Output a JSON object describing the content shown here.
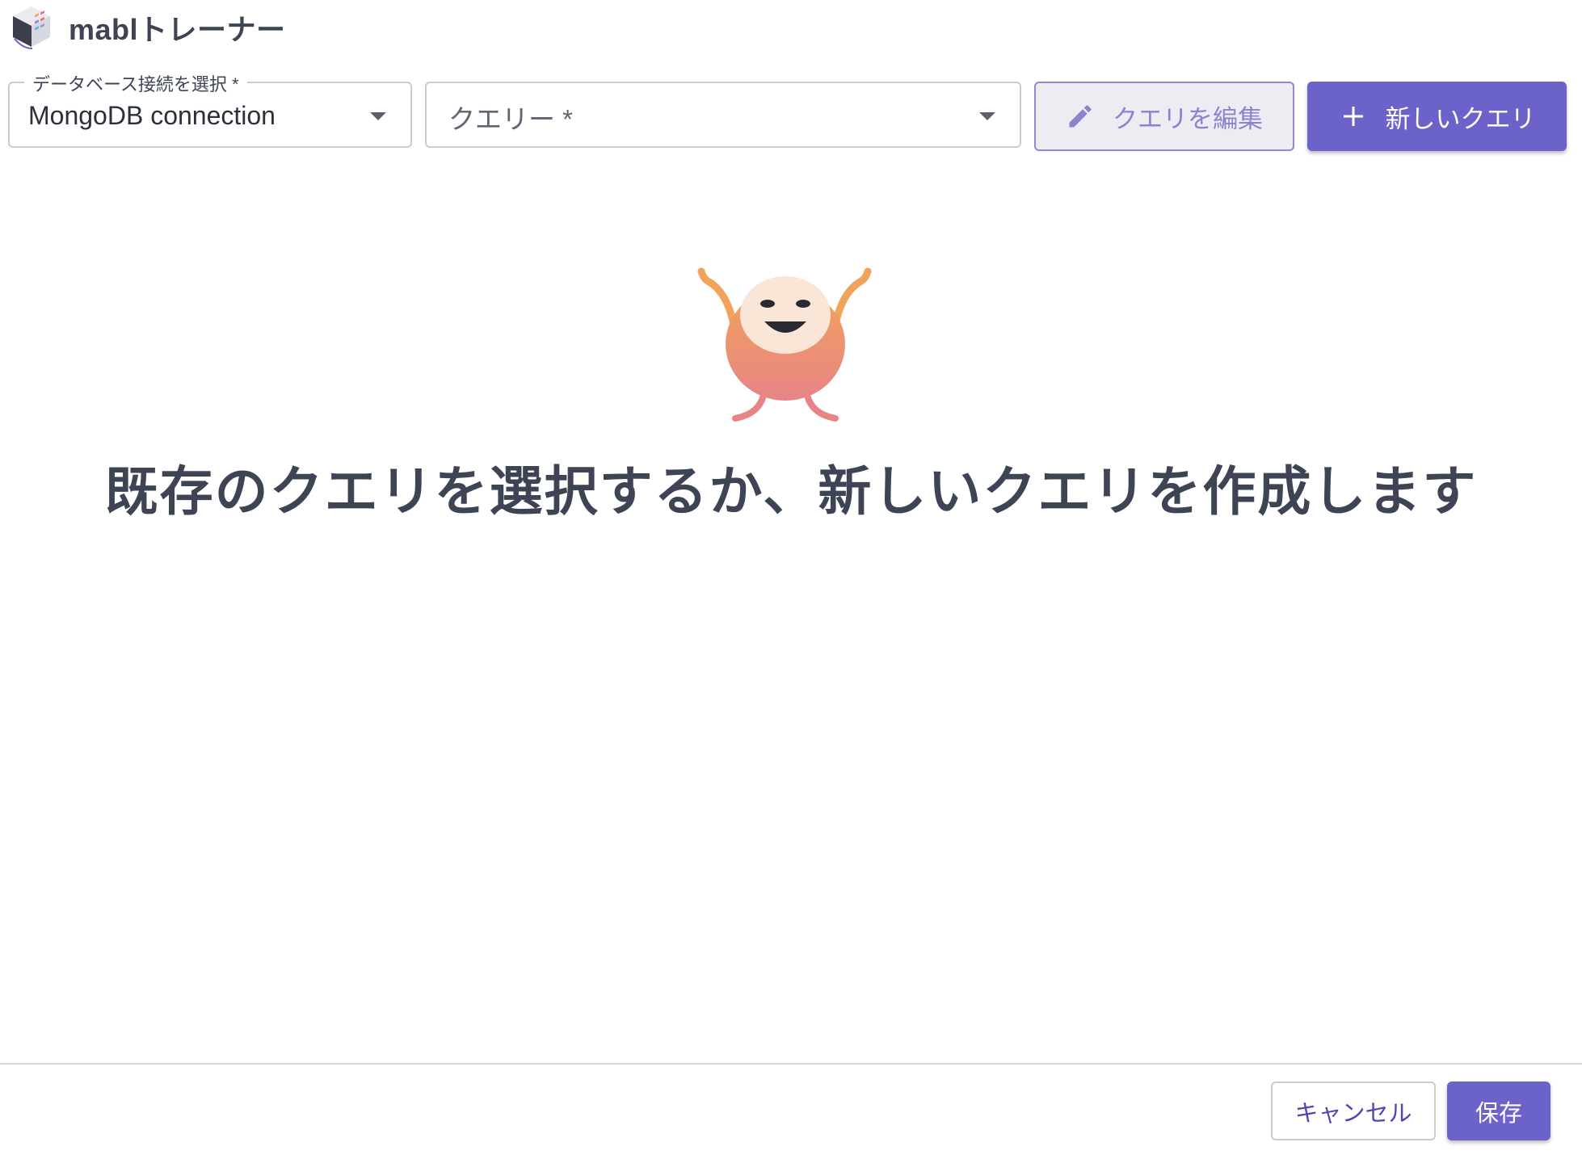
{
  "app": {
    "title": "mablトレーナー",
    "logo_icon": "mabl-cube-logo-icon"
  },
  "toolbar": {
    "db_select": {
      "label": "データベース接続を選択 *",
      "value": "MongoDB connection",
      "icon": "chevron-down-icon"
    },
    "query_select": {
      "placeholder": "クエリー *",
      "icon": "chevron-down-icon"
    },
    "edit_query": {
      "label": "クエリを編集",
      "icon": "pencil-icon",
      "disabled": true
    },
    "new_query": {
      "label": "新しいクエリ",
      "icon": "plus-icon"
    }
  },
  "empty_state": {
    "illustration": "mabl-mascot-illustration",
    "message": "既存のクエリを選択するか、新しいクエリを作成します"
  },
  "footer": {
    "cancel_label": "キャンセル",
    "save_label": "保存"
  },
  "colors": {
    "primary": "#6b63c9",
    "text": "#3d4454",
    "border": "#c9cbd2",
    "disabled_bg": "#ececf2"
  }
}
